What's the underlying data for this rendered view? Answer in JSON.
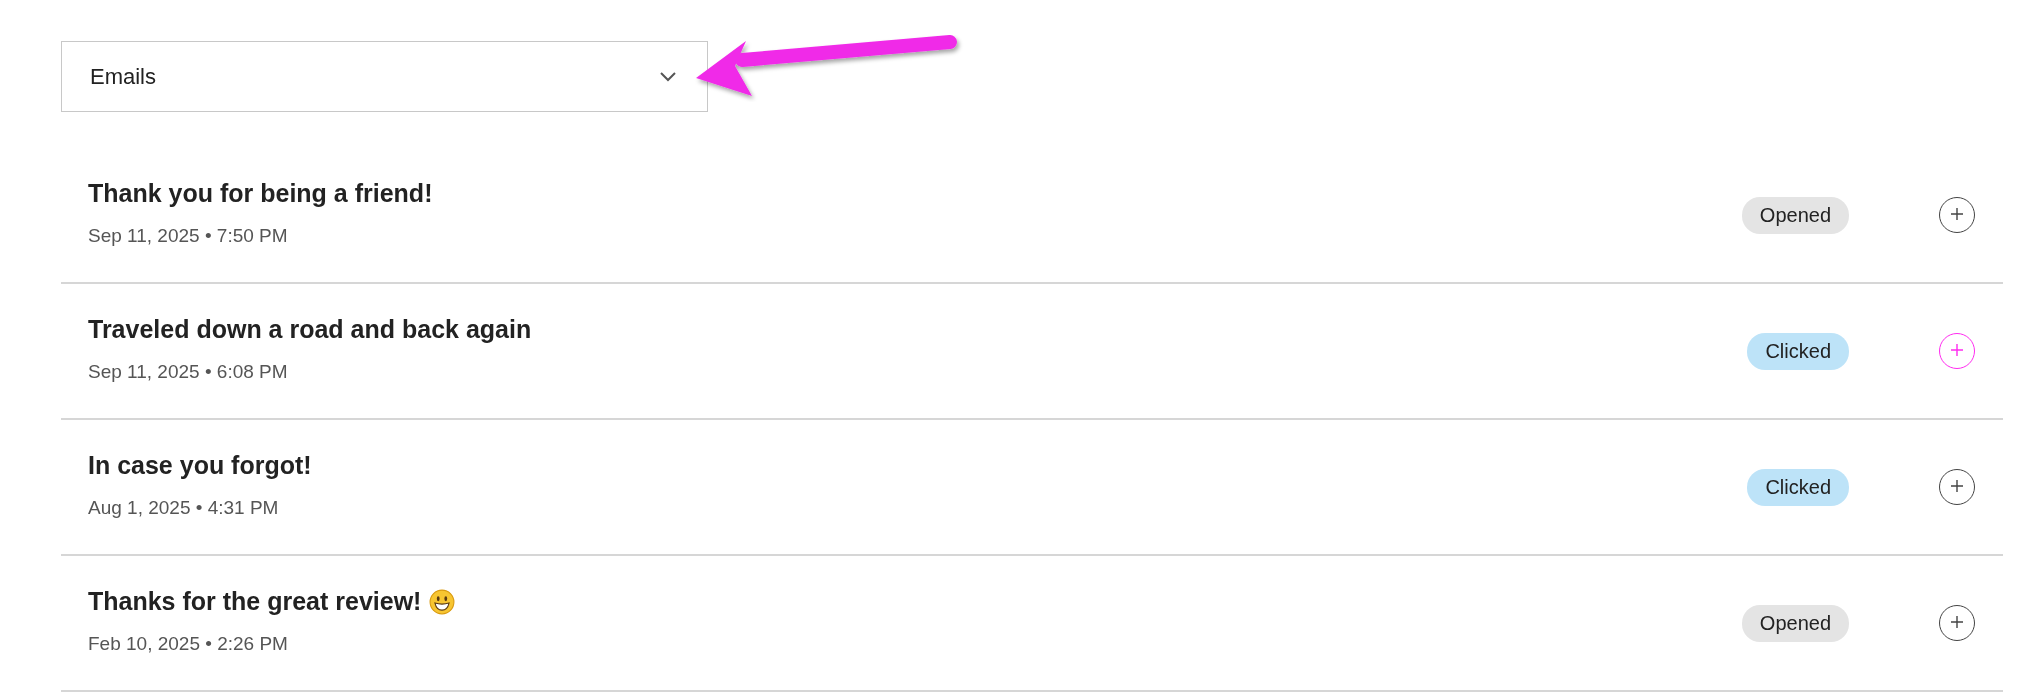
{
  "filter": {
    "value": "Emails"
  },
  "emails": [
    {
      "subject": "Thank you for being a friend!",
      "kind": "plain",
      "date": "Sep 11, 2025 • 7:50 PM",
      "status": {
        "label": "Opened",
        "kind": "opened"
      },
      "highlighted": false
    },
    {
      "subject": "Traveled down a road and back again",
      "kind": "plain",
      "date": "Sep 11, 2025 • 6:08 PM",
      "status": {
        "label": "Clicked",
        "kind": "clicked"
      },
      "highlighted": true
    },
    {
      "subject": "In case you forgot!",
      "kind": "plain",
      "date": "Aug 1, 2025 • 4:31 PM",
      "status": {
        "label": "Clicked",
        "kind": "clicked"
      },
      "highlighted": false
    },
    {
      "subject": "Thanks for the great review!",
      "kind": "smiley",
      "date": "Feb 10, 2025 • 2:26 PM",
      "status": {
        "label": "Opened",
        "kind": "opened"
      },
      "highlighted": false
    }
  ]
}
